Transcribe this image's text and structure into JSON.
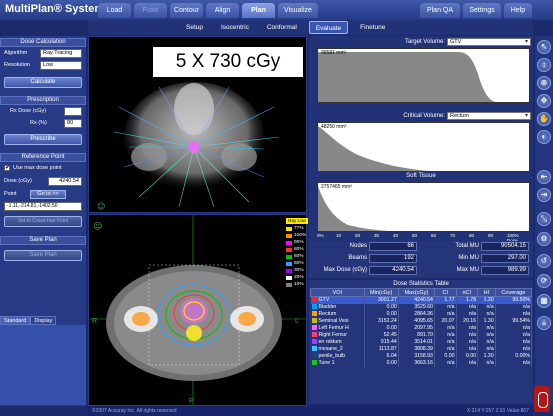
{
  "app": {
    "title": "MultiPlan® System",
    "tabs": [
      {
        "label": "Load",
        "state": "normal"
      },
      {
        "label": "Fuse",
        "state": "disabled"
      },
      {
        "label": "Contour",
        "state": "normal"
      },
      {
        "label": "Align",
        "state": "normal"
      },
      {
        "label": "Plan",
        "state": "active"
      },
      {
        "label": "Visualize",
        "state": "normal"
      }
    ],
    "right_tabs": [
      "Plan QA",
      "Settings",
      "Help"
    ]
  },
  "subtabs": [
    {
      "label": "Setup",
      "active": false
    },
    {
      "label": "Isocentric",
      "active": false
    },
    {
      "label": "Conformal",
      "active": false
    },
    {
      "label": "Evaluate",
      "active": true
    },
    {
      "label": "Finetune",
      "active": false
    }
  ],
  "left_panel": {
    "dose_calc": {
      "header": "Dose Calculation",
      "algorithm_label": "Algorithm",
      "algorithm_value": "Ray Tracing",
      "resolution_label": "Resolution",
      "resolution_value": "Low",
      "calculate_button": "Calculate"
    },
    "prescription": {
      "header": "Prescription",
      "rx_dose_label": "Rx Dose (cGy)",
      "rx_dose_value": "",
      "rx_pct_label": "Rx (%)",
      "rx_pct_value": "80",
      "prescribe_button": "Prescribe"
    },
    "reference_point": {
      "header": "Reference Point",
      "use_max_label": "Use max dose point",
      "dose_label": "Dose (cGy)",
      "dose_value": "4240.54",
      "point_label": "Point",
      "goto_button": "Go to >>",
      "point_value": "-1.11,-214.81,-1402.50",
      "set_button": "Set to Cross-hair Point"
    },
    "save_plan": {
      "header": "Save Plan",
      "save_button": "Save Plan"
    },
    "panel_tabs": [
      "Standard",
      "Display"
    ]
  },
  "viewer": {
    "overlay_text": "5 X 730 cGy",
    "orient_left": "R",
    "orient_right": "L",
    "orient_bottom": "P"
  },
  "isodose_legend": {
    "header": "Ray Low",
    "levels": [
      {
        "label": "77%",
        "color": "#ffe000"
      },
      {
        "label": "100%",
        "color": "#ff8800"
      },
      {
        "label": "90%",
        "color": "#ff00ff"
      },
      {
        "label": "80%",
        "color": "#ff3030"
      },
      {
        "label": "60%",
        "color": "#00c000"
      },
      {
        "label": "50%",
        "color": "#30a0ff"
      },
      {
        "label": "30%",
        "color": "#a000ff"
      },
      {
        "label": "20%",
        "color": "#ffffff"
      },
      {
        "label": "10%",
        "color": "#808080"
      }
    ]
  },
  "dvh": {
    "target_label": "Target Volume:",
    "target_value": "GTV",
    "target_volume": "36581 mm³",
    "critical_label": "Critical Volume:",
    "critical_value": "Rectum",
    "critical_volume": "48250 mm³",
    "soft_label": "Soft Tissue",
    "soft_volume": "2757465 mm³",
    "y_axis": "Volume",
    "x_ticks": [
      "0%",
      "10",
      "20",
      "30",
      "40",
      "50",
      "60",
      "70",
      "80",
      "90",
      "100% Dose"
    ]
  },
  "stats": {
    "nodes_label": "Nodes",
    "nodes_value": "66",
    "beams_label": "Beams",
    "beams_value": "192",
    "max_dose_label": "Max Dose (cGy)",
    "max_dose_value": "4240.54",
    "total_mu_label": "Total MU",
    "total_mu_value": "90504.15",
    "min_mu_label": "Min MU",
    "min_mu_value": "297.00",
    "max_mu_label": "Max MU",
    "max_mu_value": "989.99"
  },
  "dose_table": {
    "title": "Dose Statistics Table",
    "columns": [
      "VOI",
      "Min(cGy)",
      "Max(cGy)",
      "CI",
      "nCI",
      "HI",
      "Coverage"
    ],
    "rows": [
      {
        "color": "#ff2020",
        "name": "GTV",
        "min": "3001.27",
        "max": "4240.54",
        "ci": "1.77",
        "nci": "1.78",
        "hi": "1.30",
        "cov": "99.50%",
        "selected": true
      },
      {
        "color": "#00a0ff",
        "name": "Bladder",
        "min": "0.00",
        "max": "3529.60",
        "ci": "n/a",
        "nci": "n/a",
        "hi": "n/a",
        "cov": "n/a",
        "selected": false
      },
      {
        "color": "#ffa000",
        "name": "Rectum",
        "min": "0.00",
        "max": "2864.36",
        "ci": "n/a",
        "nci": "n/a",
        "hi": "n/a",
        "cov": "n/a",
        "selected": false
      },
      {
        "color": "#c0c000",
        "name": "Seminal Vesi",
        "min": "3152.24",
        "max": "4095.65",
        "ci": "20.07",
        "nci": "20.16",
        "hi": "1.30",
        "cov": "99.54%",
        "selected": false
      },
      {
        "color": "#ff60ff",
        "name": "Left Femur H",
        "min": "0.00",
        "max": "2097.95",
        "ci": "n/a",
        "nci": "n/a",
        "hi": "n/a",
        "cov": "n/a",
        "selected": false
      },
      {
        "color": "#ff4080",
        "name": "Right Femur",
        "min": "52.45",
        "max": "891.70",
        "ci": "n/a",
        "nci": "n/a",
        "hi": "n/a",
        "cov": "n/a",
        "selected": false
      },
      {
        "color": "#a040ff",
        "name": "en rektum",
        "min": "915.44",
        "max": "3514.01",
        "ci": "n/a",
        "nci": "n/a",
        "hi": "n/a",
        "cov": "n/a",
        "selected": false
      },
      {
        "color": "#40c0ff",
        "name": "mesane_2",
        "min": "1113.87",
        "max": "3808.39",
        "ci": "n/a",
        "nci": "n/a",
        "hi": "n/a",
        "cov": "n/a",
        "selected": false
      },
      {
        "color": "#204080",
        "name": "penile_bulb",
        "min": "6.04",
        "max": "3158.93",
        "ci": "0.00",
        "nci": "0.00",
        "hi": "1.30",
        "cov": "0.00%",
        "selected": false
      },
      {
        "color": "#20c020",
        "name": "Tune 1",
        "min": "0.00",
        "max": "3663.16",
        "ci": "n/a",
        "nci": "n/a",
        "hi": "n/a",
        "cov": "n/a",
        "selected": false
      }
    ]
  },
  "status": {
    "copyright": "©2007 Accuray Inc. All rights reserved",
    "coords": "X:214  Y:257  Z:91  Value:807"
  },
  "toolbar_icons": [
    "pointer-icon",
    "scroll-icon",
    "zoom-icon",
    "pan-icon",
    "hand-icon",
    "contrast-icon",
    "collapse-icon",
    "expand-icon",
    "measure-icon",
    "settings-icon",
    "reset-icon",
    "rotate-icon",
    "layout-icon",
    "download-icon"
  ]
}
